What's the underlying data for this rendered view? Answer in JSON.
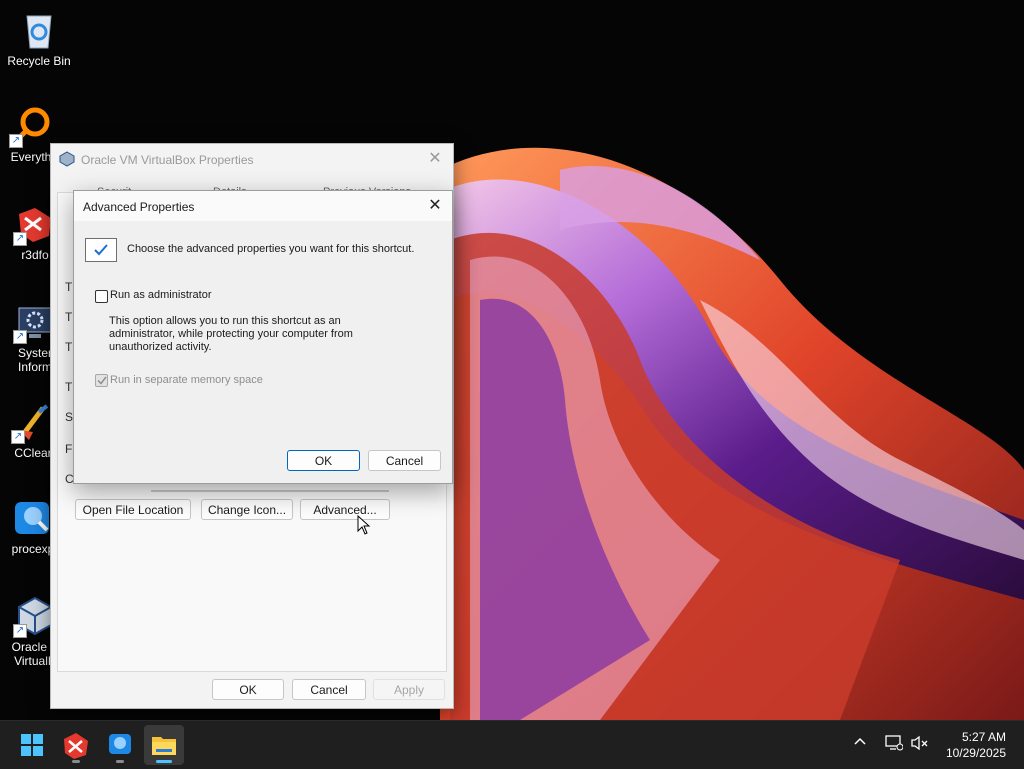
{
  "desktop": {
    "icons": [
      {
        "label": "Recycle Bin",
        "icon": "recycle-bin-icon"
      },
      {
        "label": "Everyth",
        "icon": "everything-search-icon"
      },
      {
        "label": "r3dfo",
        "icon": "r3dfox-icon"
      },
      {
        "label": "Syster",
        "label2": "Inform",
        "icon": "system-information-icon"
      },
      {
        "label": "CClear",
        "icon": "ccleaner-icon"
      },
      {
        "label": "procexp",
        "icon": "process-explorer-icon"
      },
      {
        "label": "Oracle V",
        "label2": "VirtualB",
        "icon": "virtualbox-icon"
      }
    ]
  },
  "properties_window": {
    "title": "Oracle VM VirtualBox Properties",
    "tabs_partial": [
      "Securit",
      "Details",
      "Previous Versions"
    ],
    "side_chars": [
      "T",
      "T",
      "T",
      "T",
      "S",
      "F",
      "C"
    ],
    "buttons": {
      "open_file_location": "Open File Location",
      "change_icon": "Change Icon...",
      "advanced": "Advanced..."
    },
    "footer": {
      "ok": "OK",
      "cancel": "Cancel",
      "apply": "Apply"
    }
  },
  "advanced_dialog": {
    "title": "Advanced Properties",
    "info_text": "Choose the advanced properties you want for this shortcut.",
    "run_as_admin": {
      "label": "Run as administrator",
      "checked": false
    },
    "description": "This option allows you to run this shortcut as an administrator, while protecting your computer from unauthorized activity.",
    "separate_memory": {
      "label": "Run in separate memory space",
      "checked": true,
      "disabled": true
    },
    "ok": "OK",
    "cancel": "Cancel"
  },
  "taskbar": {
    "apps": [
      "start-icon",
      "r3dfox-icon",
      "process-explorer-icon",
      "file-explorer-icon"
    ],
    "clock": {
      "time": "5:27 AM",
      "date": "10/29/2025"
    }
  }
}
